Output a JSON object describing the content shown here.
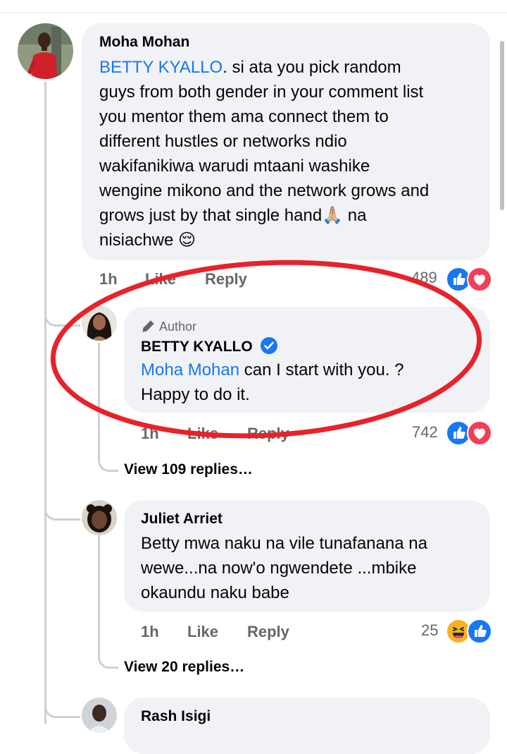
{
  "colors": {
    "accent": "#1877f2",
    "bubble": "#f0f2f5",
    "meta": "#65676b",
    "annotation": "#e8222a"
  },
  "comments": [
    {
      "name": "Moha Mohan",
      "mention": "BETTY KYALLO",
      "text_lines": [
        ". si ata you pick random",
        "guys from both gender in your comment list",
        "you mentor them ama connect them to",
        "different hustles or networks ndio",
        "wakifanikiwa warudi mtaani washike",
        "wengine mikono and the network grows and",
        "grows just by that single hand🙏🏼 na",
        "nisiachwe 😌"
      ],
      "time": "1h",
      "like": "Like",
      "reply": "Reply",
      "count": "489",
      "reactions": [
        "like-icon",
        "love-icon"
      ]
    },
    {
      "badge": "Author",
      "name": "BETTY KYALLO",
      "mention": "Moha Mohan",
      "text_lines": [
        " can I start with you. ?",
        "Happy to do it."
      ],
      "time": "1h",
      "like": "Like",
      "reply": "Reply",
      "count": "742",
      "reactions": [
        "like-icon",
        "love-icon"
      ],
      "view_replies": "View 109 replies…"
    },
    {
      "name": "Juliet Arriet",
      "text_lines": [
        "Betty mwa naku na vile tunafanana na",
        "wewe...na now'o ngwendete ...mbike",
        "okaundu naku babe"
      ],
      "time": "1h",
      "like": "Like",
      "reply": "Reply",
      "count": "25",
      "reactions": [
        "haha-icon",
        "like-icon"
      ],
      "view_replies": "View 20 replies…"
    },
    {
      "name": "Rash Isigi"
    }
  ]
}
